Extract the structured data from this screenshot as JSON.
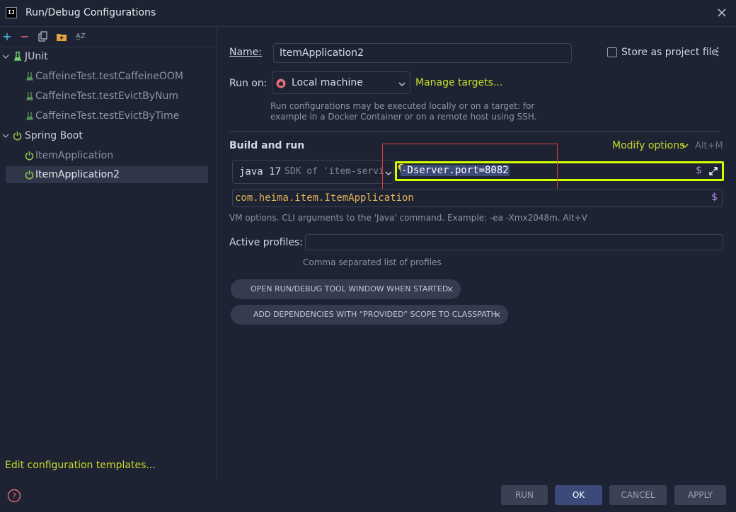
{
  "window": {
    "title": "Run/Debug Configurations",
    "logo_text": "IJ"
  },
  "toolbar": {
    "add": "+",
    "remove": "−",
    "sort": "A̲Z"
  },
  "tree": {
    "groups": [
      {
        "label": "JUnit",
        "items": [
          "CaffeineTest.testCaffeineOOM",
          "CaffeineTest.testEvictByNum",
          "CaffeineTest.testEvictByTime"
        ]
      },
      {
        "label": "Spring Boot",
        "items": [
          "ItemApplication",
          "ItemApplication2"
        ]
      }
    ],
    "selected": "ItemApplication2"
  },
  "edit_templates": "Edit configuration templates...",
  "form": {
    "name_label": "Name:",
    "name_value": "ItemApplication2",
    "store_label": "Store as project file",
    "run_on_label": "Run on:",
    "run_on_value": "Local machine",
    "manage_targets": "Manage targets...",
    "run_on_hint_1": "Run configurations may be executed locally or on a target: for",
    "run_on_hint_2": "example in a Docker Container or on a remote host using SSH.",
    "build_run_label": "Build and run",
    "modify_options": "Modify options",
    "modify_shortcut": "Alt+M",
    "sdk_value": "java 17",
    "sdk_detail": "SDK of 'item-servi",
    "vm_options_value": "-Dserver.port=8082",
    "main_class_value": "com.heima.item.ItemApplication",
    "vm_hint": "VM options. CLI arguments to the 'Java' command. Example: -ea -Xmx2048m. Alt+V",
    "active_profiles_label": "Active profiles:",
    "active_profiles_value": "",
    "profiles_hint": "Comma separated list of profiles",
    "chips": [
      "OPEN RUN/DEBUG TOOL WINDOW WHEN STARTED",
      "ADD DEPENDENCIES WITH “PROVIDED” SCOPE TO CLASSPATH"
    ],
    "dollar": "$"
  },
  "buttons": {
    "run": "RUN",
    "ok": "OK",
    "cancel": "CANCEL",
    "apply": "APPLY"
  },
  "colors": {
    "background": "#1e2333",
    "accent_link": "#c8dc2a",
    "highlight_border": "#d4ff00",
    "annotation_box": "#e03a3a",
    "primary_button": "#3b4a7a"
  }
}
